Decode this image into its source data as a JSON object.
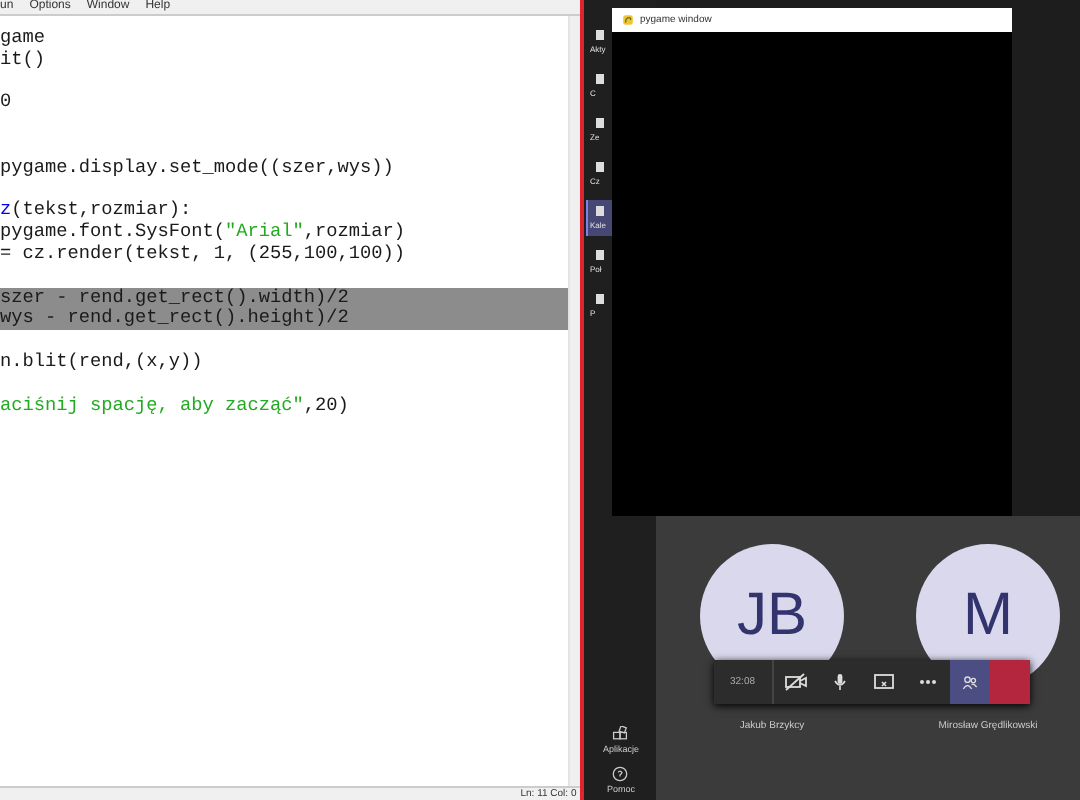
{
  "editor": {
    "menu": [
      "un",
      "Options",
      "Window",
      "Help"
    ],
    "lines": [
      {
        "selected": false,
        "segments": [
          {
            "kind": "plain",
            "text": "game"
          }
        ]
      },
      {
        "selected": false,
        "segments": [
          {
            "kind": "plain",
            "text": "it()"
          }
        ]
      },
      {
        "selected": false
      },
      {
        "selected": false,
        "segments": [
          {
            "kind": "plain",
            "text": "0"
          }
        ]
      },
      {
        "selected": false
      },
      {
        "selected": false
      },
      {
        "selected": false,
        "segments": [
          {
            "kind": "plain",
            "text": "pygame.display.set_mode((szer,wys))"
          }
        ]
      },
      {
        "selected": false
      },
      {
        "selected": false,
        "segments": [
          {
            "kind": "name",
            "text": "z"
          },
          {
            "kind": "plain",
            "text": "(tekst,rozmiar):"
          }
        ]
      },
      {
        "selected": false,
        "segments": [
          {
            "kind": "plain",
            "text": "pygame.font.SysFont("
          },
          {
            "kind": "string",
            "text": "\"Arial\""
          },
          {
            "kind": "plain",
            "text": ",rozmiar)"
          }
        ]
      },
      {
        "selected": false,
        "segments": [
          {
            "kind": "plain",
            "text": "= cz.render(tekst, 1, (255,100,100))"
          }
        ]
      },
      {
        "selected": false
      },
      {
        "selected": true,
        "segments": [
          {
            "kind": "plain",
            "text": "szer - rend.get_rect().width)/2"
          }
        ]
      },
      {
        "selected": true,
        "segments": [
          {
            "kind": "plain",
            "text": "wys - rend.get_rect().height)/2"
          }
        ]
      },
      {
        "selected": false
      },
      {
        "selected": false,
        "segments": [
          {
            "kind": "plain",
            "text": "n.blit(rend,(x,y))"
          }
        ]
      },
      {
        "selected": false
      },
      {
        "selected": false,
        "segments": [
          {
            "kind": "string",
            "text": "aciśnij spację, aby zacząć\""
          },
          {
            "kind": "plain",
            "text": ",20)"
          }
        ]
      }
    ],
    "status": "Ln: 11 Col: 0"
  },
  "teams": {
    "sidebar_top": [
      {
        "label": "Akty",
        "selected": false
      },
      {
        "label": "C",
        "selected": false
      },
      {
        "label": "Ze",
        "selected": false
      },
      {
        "label": "Cz",
        "selected": false
      },
      {
        "label": "Kale",
        "selected": true
      },
      {
        "label": "Poł",
        "selected": false
      },
      {
        "label": "P",
        "selected": false
      }
    ],
    "sidebar_bottom": [
      {
        "label": "Aplikacje"
      },
      {
        "label": "Pomoc"
      }
    ],
    "pygame_window": {
      "title": "pygame window"
    },
    "participants": [
      {
        "initials": "JB",
        "name": "Jakub Brzykcy"
      },
      {
        "initials": "M",
        "name": "Mirosław Grędlikowski"
      }
    ],
    "call_bar": {
      "timer": "32:08"
    }
  }
}
